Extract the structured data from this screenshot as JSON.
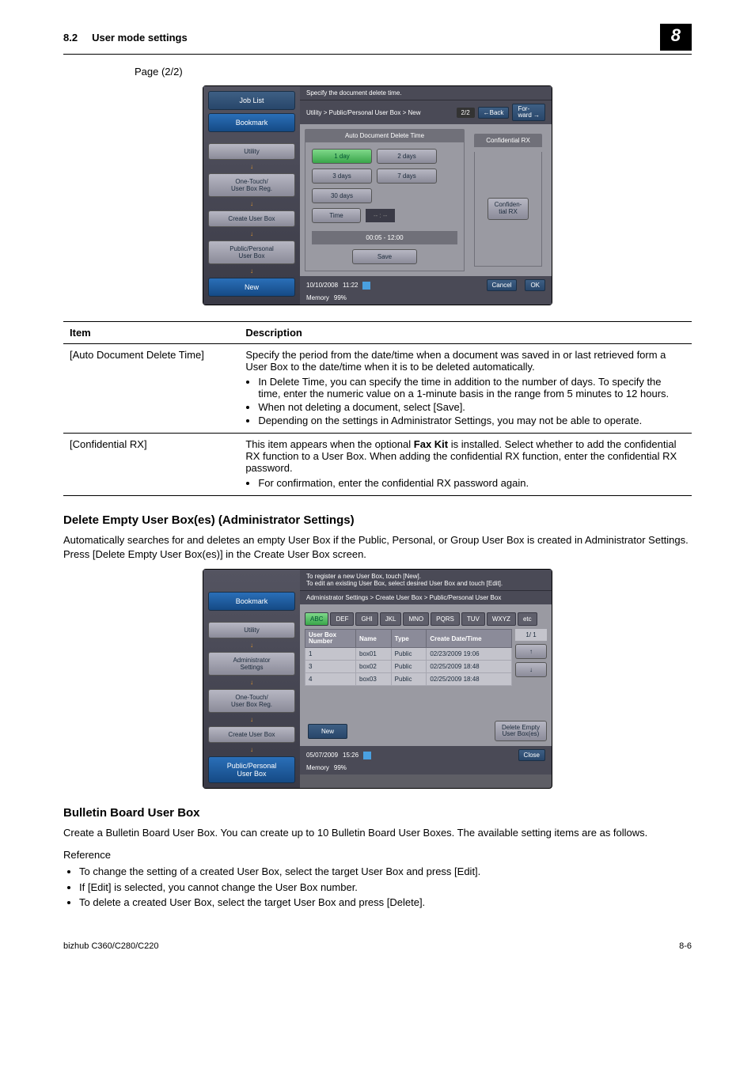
{
  "header": {
    "section_num": "8.2",
    "section_title": "User mode settings",
    "tab": "8"
  },
  "page_indicator": "Page (2/2)",
  "shot1": {
    "joblist": "Job List",
    "bookmark": "Bookmark",
    "top": "Specify the document delete time.",
    "crumb": "Utility > Public/Personal User Box > New",
    "pg": "2/2",
    "back": "←Back",
    "fwd": "For-\nward →",
    "tab_auto": "Auto Document Delete Time",
    "tab_conf": "Confidential RX",
    "sidebar": [
      "Utility",
      "One-Touch/\nUser Box Reg.",
      "Create User Box",
      "Public/Personal\nUser Box",
      "New"
    ],
    "right_btn": "Confiden-\ntial RX",
    "opts": {
      "d1": "1 day",
      "d2": "2 days",
      "d3": "3 days",
      "d7": "7 days",
      "d30": "30 days",
      "time": "Time",
      "save": "Save"
    },
    "time_placeholder": "-- : --",
    "time_range": "00:05   -   12:00",
    "date": "10/10/2008",
    "clock": "11:22",
    "mem": "Memory",
    "mempct": "99%",
    "cancel": "Cancel",
    "ok": "OK"
  },
  "table": {
    "h_item": "Item",
    "h_desc": "Description",
    "r1_item": "[Auto Document Delete Time]",
    "r1_desc": "Specify the period from the date/time when a document was saved in or last retrieved form a User Box to the date/time when it is to be deleted automatically.",
    "r1_b1": "In Delete Time, you can specify the time in addition to the number of days. To specify the time, enter the numeric value on a 1-minute basis in the range from 5 minutes to 12 hours.",
    "r1_b2": "When not deleting a document, select [Save].",
    "r1_b3": "Depending on the settings in Administrator Settings, you may not be able to operate.",
    "r2_item": "[Confidential RX]",
    "r2_desc": "This item appears when the optional Fax Kit is installed. Select whether to add the confidential RX function to a User Box. When adding the confidential RX function, enter the confidential RX password.",
    "r2_b1": "For confirmation, enter the confidential RX password again."
  },
  "heading1": "Delete Empty User Box(es) (Administrator Settings)",
  "para1": "Automatically searches for and deletes an empty User Box if the Public, Personal, or Group User Box is created in Administrator Settings. Press [Delete Empty User Box(es)] in the Create User Box screen.",
  "shot2": {
    "bookmark": "Bookmark",
    "top": "To register a new User Box, touch [New].\nTo edit an existing User Box, select desired User Box and touch [Edit].",
    "crumb": "Administrator Settings > Create User Box > Public/Personal User Box",
    "tabs": [
      "ABC",
      "DEF",
      "GHI",
      "JKL",
      "MNO",
      "PQRS",
      "TUV",
      "WXYZ",
      "etc"
    ],
    "sidebar": [
      "Utility",
      "Administrator\nSettings",
      "One-Touch/\nUser Box Reg.",
      "Create User Box",
      "Public/Personal\nUser Box"
    ],
    "page": "1/  1",
    "cols": {
      "num": "User Box\nNumber",
      "name": "Name",
      "type": "Type",
      "date": "Create Date/Time"
    },
    "rows": [
      {
        "n": "1",
        "name": "box01",
        "type": "Public",
        "date": "02/23/2009 19:06"
      },
      {
        "n": "3",
        "name": "box02",
        "type": "Public",
        "date": "02/25/2009 18:48"
      },
      {
        "n": "4",
        "name": "box03",
        "type": "Public",
        "date": "02/25/2009 18:48"
      }
    ],
    "new": "New",
    "del": "Delete Empty\nUser Box(es)",
    "close": "Close",
    "date": "05/07/2009",
    "clock": "15:26",
    "mem": "Memory",
    "mempct": "99%"
  },
  "heading2": "Bulletin Board User Box",
  "para2": "Create a Bulletin Board User Box. You can create up to 10 Bulletin Board User Boxes. The available setting items are as follows.",
  "ref": "Reference",
  "ref_b1": "To change the setting of a created User Box, select the target User Box and press [Edit].",
  "ref_b2": "If [Edit] is selected, you cannot change the User Box number.",
  "ref_b3": "To delete a created User Box, select the target User Box and press [Delete].",
  "footer": {
    "model": "bizhub C360/C280/C220",
    "page": "8-6"
  }
}
